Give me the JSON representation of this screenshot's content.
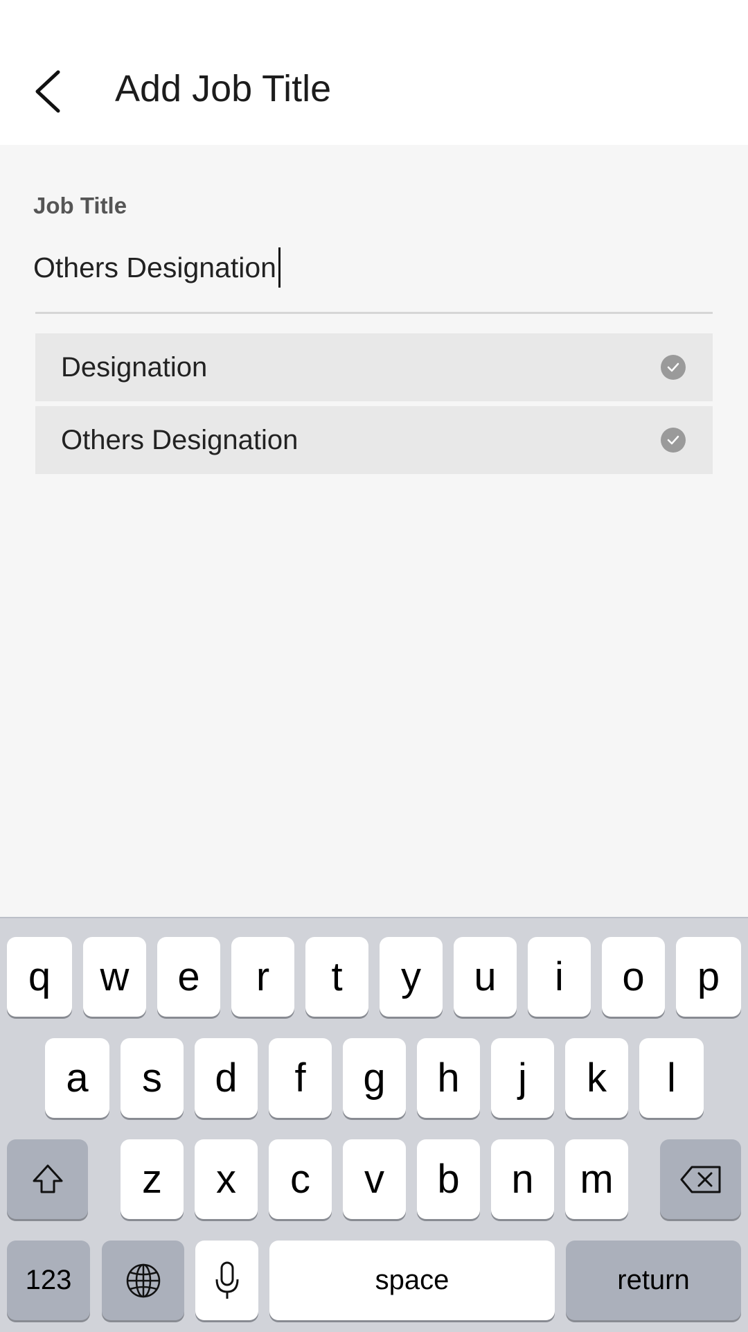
{
  "header": {
    "title": "Add Job Title",
    "back_icon": "chevron-left-icon"
  },
  "form": {
    "label": "Job Title",
    "value": "Others Designation"
  },
  "suggestions": [
    {
      "label": "Designation",
      "icon": "check-circle-icon"
    },
    {
      "label": "Others Designation",
      "icon": "check-circle-icon"
    }
  ],
  "keyboard": {
    "row1": [
      "q",
      "w",
      "e",
      "r",
      "t",
      "y",
      "u",
      "i",
      "o",
      "p"
    ],
    "row2": [
      "a",
      "s",
      "d",
      "f",
      "g",
      "h",
      "j",
      "k",
      "l"
    ],
    "row3": [
      "z",
      "x",
      "c",
      "v",
      "b",
      "n",
      "m"
    ],
    "shift_icon": "shift-icon",
    "backspace_icon": "backspace-icon",
    "numbers_label": "123",
    "globe_icon": "globe-icon",
    "mic_icon": "microphone-icon",
    "space_label": "space",
    "return_label": "return"
  },
  "colors": {
    "background": "#f6f6f6",
    "header": "#ffffff",
    "suggestion": "#e8e8e8",
    "keyboard": "#d1d3d9"
  }
}
